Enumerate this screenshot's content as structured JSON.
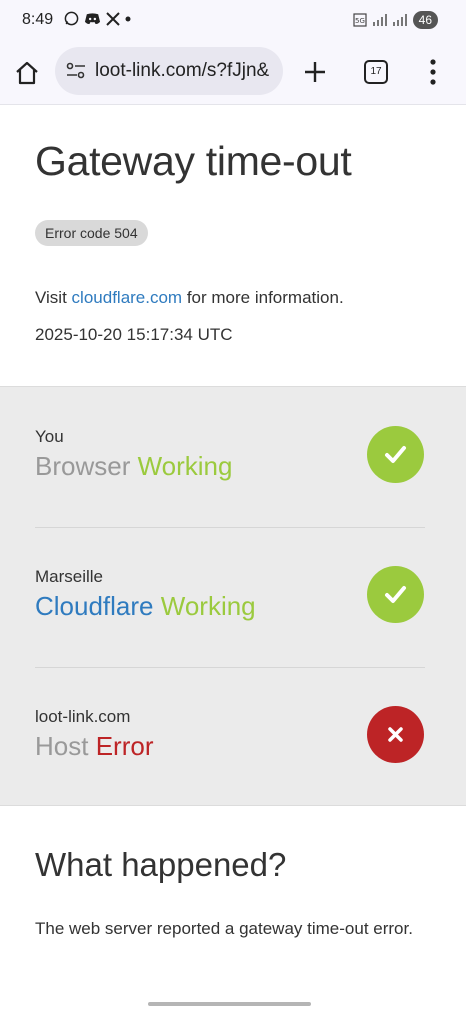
{
  "status_bar": {
    "time": "8:49",
    "left_icons": [
      "whatsapp-icon",
      "discord-icon",
      "x-icon",
      "dot-icon"
    ],
    "right_icons": [
      "5g-icon",
      "signal-icon",
      "signal-icon"
    ],
    "battery": "46"
  },
  "browser": {
    "url": "loot-link.com/s?fJjn&",
    "tab_count": "17"
  },
  "page": {
    "title": "Gateway time-out",
    "error_badge": "Error code 504",
    "visit_prefix": "Visit ",
    "visit_link": "cloudflare.com",
    "visit_suffix": " for more information.",
    "timestamp": "2025-10-20 15:17:34 UTC"
  },
  "status_rows": [
    {
      "location": "You",
      "name": "Browser",
      "state": "Working",
      "result": "ok"
    },
    {
      "location": "Marseille",
      "name": "Cloudflare",
      "state": "Working",
      "result": "ok"
    },
    {
      "location": "loot-link.com",
      "name": "Host",
      "state": "Error",
      "result": "error"
    }
  ],
  "what_happened": {
    "heading": "What happened?",
    "body": "The web server reported a gateway time-out error."
  },
  "colors": {
    "working_green": "#9bca3e",
    "error_red": "#bd2426",
    "link_blue": "#2f7bbf"
  }
}
